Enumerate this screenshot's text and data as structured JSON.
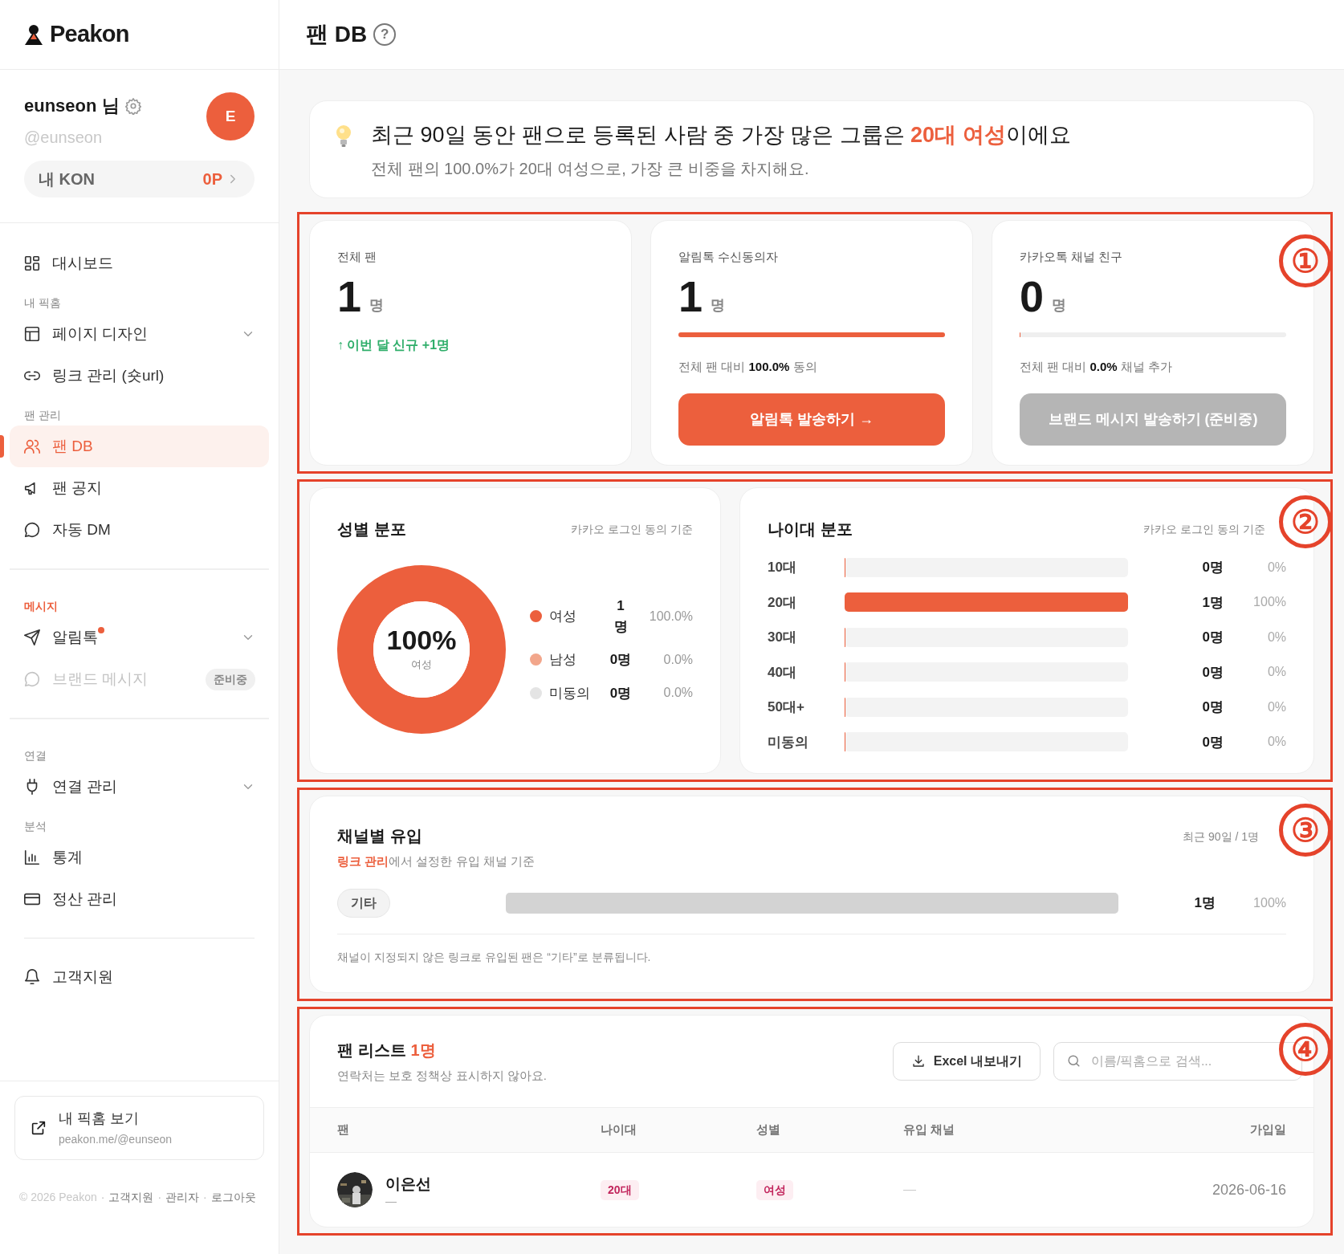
{
  "sidebar": {
    "logo": "Peakon",
    "profile": {
      "name": "eunseon 님",
      "handle": "@eunseon",
      "avatar_letter": "E",
      "kon_label": "내 KON",
      "kon_value": "0P"
    },
    "groups": [
      {
        "items": [
          {
            "label": "대시보드",
            "selected": false
          }
        ]
      },
      {
        "heading": "내 픽홈",
        "items": [
          {
            "label": "페이지 디자인",
            "selected": false,
            "expandable": true
          },
          {
            "label": "링크 관리 (숏url)",
            "selected": false
          }
        ]
      },
      {
        "heading": "팬 관리",
        "rule_after": true,
        "items": [
          {
            "label": "팬 DB",
            "selected": true
          },
          {
            "label": "팬 공지",
            "selected": false
          },
          {
            "label": "자동 DM",
            "selected": false
          }
        ]
      },
      {
        "heading": "메시지",
        "accent": true,
        "rule_after": true,
        "items": [
          {
            "label": "알림톡",
            "selected": false,
            "expandable": true,
            "dot": true
          },
          {
            "label": "브랜드 메시지",
            "selected": false,
            "disabled": true,
            "tag": "준비중"
          }
        ]
      },
      {
        "heading": "연결",
        "items": [
          {
            "label": "연결 관리",
            "selected": false,
            "expandable": true
          }
        ]
      },
      {
        "heading": "분석",
        "rule_after": true,
        "items": [
          {
            "label": "통계",
            "selected": false
          },
          {
            "label": "정산 관리",
            "selected": false
          }
        ]
      },
      {
        "items": [
          {
            "label": "고객지원",
            "selected": false
          }
        ]
      }
    ],
    "page_card": {
      "title": "내 픽홈 보기",
      "url": "peakon.me/@eunseon"
    },
    "footer": {
      "copyright": "© 2026 Peakon",
      "separator": "·",
      "links": [
        "고객지원",
        "관리자",
        "로그아웃"
      ]
    }
  },
  "header": {
    "title": "팬 DB",
    "help": "?"
  },
  "insight": {
    "title": "최근 90일 동안 팬으로 등록된 사람 중 가장 많은 그룹은 **20대 여성**이에요",
    "subtitle": "전체 팬의 100.0%가 20대 여성으로, 가장 큰 비중을 차지해요."
  },
  "stats": {
    "marker": "①",
    "cards": [
      {
        "kind": "plain",
        "label": "전체 팬",
        "value": "1",
        "unit": "명",
        "delta": "↑ 이번 달 신규 +1명"
      },
      {
        "kind": "meter",
        "label": "알림톡 수신동의자",
        "value": "1",
        "unit": "명",
        "level": 1,
        "note": "전체 팬 대비 **100.0%** 동의",
        "button": "알림톡 발송하기 →",
        "disabled": false
      },
      {
        "kind": "meter",
        "label": "카카오톡 채널 친구",
        "value": "0",
        "unit": "명",
        "level": 0,
        "note": "전체 팬 대비 **0.0%** 채널 추가",
        "button": "브랜드 메시지 발송하기 (준비중)",
        "disabled": true
      }
    ]
  },
  "distribution": {
    "marker": "②",
    "gender": {
      "title": "성별 분포",
      "basis": "카카오 로그인 동의 기준",
      "center_value": "100%",
      "center_label": "여성",
      "chart_data": {
        "type": "donut",
        "categories": [
          "여성",
          "남성",
          "미동의"
        ],
        "series": [
          {
            "values": [
              1,
              0,
              0
            ]
          }
        ]
      },
      "legend": [
        {
          "count": "1\n명",
          "share": "100.0%",
          "color": "#ec5f3d"
        },
        {
          "count": "0명",
          "share": "0.0%",
          "color": "#f2a68b"
        },
        {
          "count": "0명",
          "share": "0.0%",
          "color": "#e4e4e4"
        }
      ]
    },
    "age": {
      "title": "나이대 분포",
      "basis": "카카오 로그인 동의 기준",
      "rows": [
        {
          "label": "10대",
          "level": 0,
          "count": "0명",
          "share": "0%"
        },
        {
          "label": "20대",
          "level": 1,
          "count": "1명",
          "share": "100%"
        },
        {
          "label": "30대",
          "level": 0,
          "count": "0명",
          "share": "0%"
        },
        {
          "label": "40대",
          "level": 0,
          "count": "0명",
          "share": "0%"
        },
        {
          "label": "50대+",
          "level": 0,
          "count": "0명",
          "share": "0%"
        },
        {
          "label": "미동의",
          "level": 0,
          "count": "0명",
          "share": "0%"
        }
      ]
    }
  },
  "channels": {
    "marker": "③",
    "title": "채널별 유입",
    "subtitle": "**링크 관리**에서 설정한 유입 채널 기준",
    "period": "최근 90일 / 1명",
    "rows": [
      {
        "tag": "기타",
        "level": 1,
        "count": "1명",
        "share": "100%"
      }
    ],
    "note": "채널이 지정되지 않은 링크로 유입된 팬은 “기타”로 분류됩니다."
  },
  "fan_list": {
    "marker": "④",
    "title": "팬 리스트",
    "count": "1명",
    "subtitle": "연락처는 보호 정책상 표시하지 않아요.",
    "export_button": "Excel 내보내기",
    "search": {
      "placeholder": "이름/픽홈으로 검색..."
    },
    "columns": [
      "팬",
      "나이대",
      "성별",
      "유입 채널",
      "가입일"
    ],
    "rows": [
      {
        "name": "이은선",
        "sub": "—",
        "age": "20대",
        "gender": "여성",
        "channel": "—",
        "joined": "2026-06-16"
      }
    ]
  }
}
